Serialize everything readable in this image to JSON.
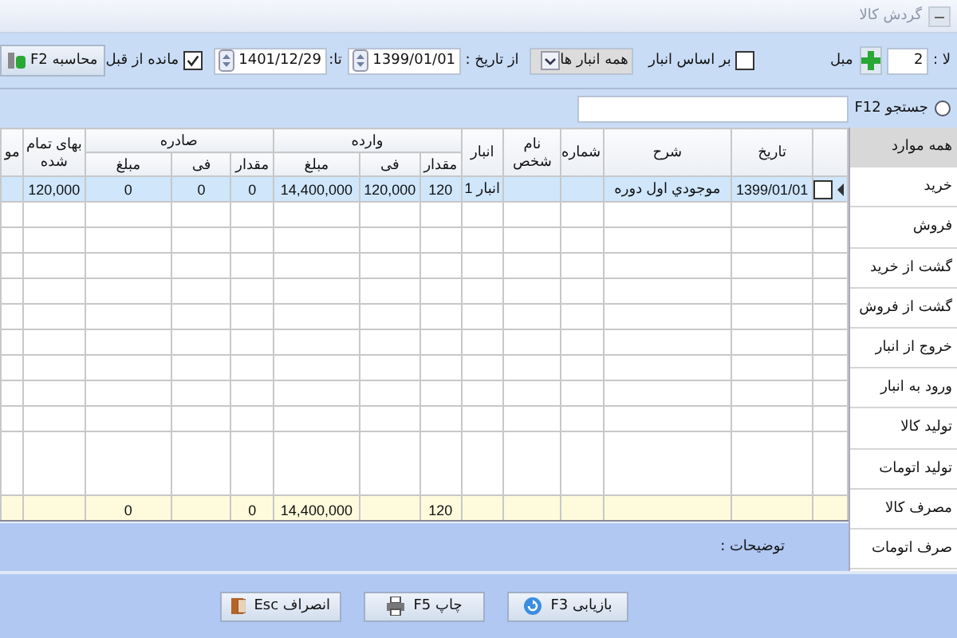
{
  "window": {
    "title": "گردش کالا"
  },
  "toolbar": {
    "item_label": "لا :",
    "item_value": "2",
    "amount_label": "مبل",
    "by_warehouse": {
      "label": "بر اساس انبار",
      "checked": false
    },
    "warehouse": {
      "value": "همه انبار ها"
    },
    "from_label": "از تاریخ :",
    "from_date": "1399/01/01",
    "to_label": "تا:",
    "to_date": "1401/12/29",
    "carry_over": {
      "label": "مانده از قبل",
      "checked": true
    },
    "calculate_button": "محاسبه F2"
  },
  "search": {
    "label": "جستجو F12",
    "selected": false
  },
  "sidebar": {
    "items": [
      {
        "label": "همه موارد",
        "selected": true
      },
      {
        "label": "خرید",
        "selected": false
      },
      {
        "label": "فروش",
        "selected": false
      },
      {
        "label": "گشت از خرید",
        "selected": false
      },
      {
        "label": "گشت از فروش",
        "selected": false
      },
      {
        "label": "خروج از انبار",
        "selected": false
      },
      {
        "label": "ورود به انبار",
        "selected": false
      },
      {
        "label": "تولید کالا",
        "selected": false
      },
      {
        "label": "تولید اتومات",
        "selected": false
      },
      {
        "label": "مصرف کالا",
        "selected": false
      },
      {
        "label": "صرف اتومات",
        "selected": false
      }
    ]
  },
  "table": {
    "header_groups": [
      {
        "label": "وارده",
        "colspan": 3
      },
      {
        "label": "صادره",
        "colspan": 3
      }
    ],
    "columns": [
      {
        "label": "تاریخ",
        "grouped": false
      },
      {
        "label": "شرح",
        "grouped": false
      },
      {
        "label": "شماره",
        "grouped": false
      },
      {
        "label": "نام شخص",
        "grouped": false
      },
      {
        "label": "انبار",
        "grouped": false
      },
      {
        "label": "مقدار",
        "grouped": true
      },
      {
        "label": "فی",
        "grouped": true
      },
      {
        "label": "مبلغ",
        "grouped": true
      },
      {
        "label": "مقدار",
        "grouped": true
      },
      {
        "label": "فی",
        "grouped": true
      },
      {
        "label": "مبلغ",
        "grouped": true
      },
      {
        "label": "بهای تمام شده",
        "grouped": false
      },
      {
        "label": "مو",
        "grouped": false
      }
    ],
    "rows": [
      {
        "selected": true,
        "checked": false,
        "date": "1399/01/01",
        "description": "موجودي اول دوره",
        "warehouse": "انبار 1",
        "in_quantity": "120",
        "in_price": "120,000",
        "in_amount": "14,400,000",
        "out_quantity": "0",
        "out_price": "0",
        "out_amount": "0",
        "cost": "120,000"
      }
    ],
    "totals": {
      "in_quantity": "120",
      "in_amount": "14,400,000",
      "out_quantity": "0",
      "out_amount": "0"
    }
  },
  "notes": {
    "label": "توضیحات :"
  },
  "buttons": [
    {
      "label": "بازیابی F3",
      "kind": "refresh"
    },
    {
      "label": "چاپ F5",
      "kind": "print"
    },
    {
      "label": "انصراف Esc",
      "kind": "exit"
    }
  ]
}
